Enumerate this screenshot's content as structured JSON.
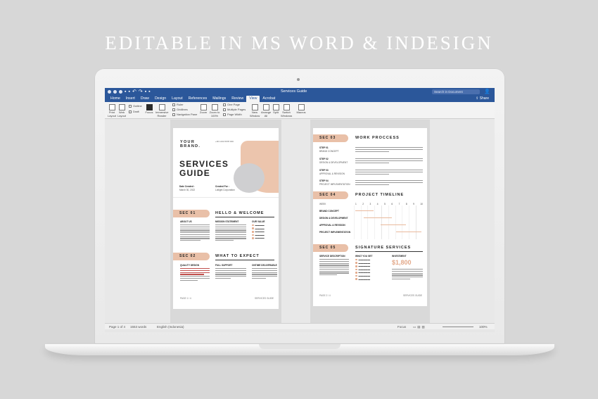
{
  "hero": {
    "title": "EDITABLE IN MS WORD & INDESIGN"
  },
  "app": {
    "doc_title": "Services Guide",
    "search_placeholder": "Search in Document",
    "share_label": "Share",
    "tabs": [
      "Home",
      "Insert",
      "Draw",
      "Design",
      "Layout",
      "References",
      "Mailings",
      "Review",
      "View",
      "Acrobat"
    ],
    "active_tab": "View",
    "ribbon": {
      "print_layout": "Print Layout",
      "web_layout": "Web Layout",
      "outline": "Outline",
      "draft": "Draft",
      "focus": "Focus",
      "immersive_reader": "Immersive Reader",
      "ruler": "Ruler",
      "gridlines": "Gridlines",
      "navigation_pane": "Navigation Pane",
      "zoom": "Zoom",
      "zoom_100": "Zoom to 100%",
      "one_page": "One Page",
      "multiple_pages": "Multiple Pages",
      "page_width": "Page Width",
      "new_window": "New Window",
      "arrange_all": "Arrange All",
      "split": "Split",
      "switch_windows": "Switch Windows",
      "macros": "Macros"
    },
    "status": {
      "page": "Page 1 of 4",
      "words": "1553 words",
      "language": "English (Indonesia)",
      "focus": "Focus",
      "zoom": "100%"
    }
  },
  "page_left": {
    "brand": "YOUR BRAND.",
    "header_meta": "+00 1234 5678 000",
    "title_line1": "SERVICES",
    "title_line2": "GUIDE",
    "date_created_label": "Date Created :",
    "date_created_value": "March 30, 2022",
    "created_for_label": "Created For :",
    "created_for_value": "Lotlight Corporation",
    "sec01": "SEC 01",
    "sec01_title": "HELLO & WELCOME",
    "about_us": "ABOUT US",
    "mission": "MISSION STATEMENT",
    "our_value": "OUR VALUE",
    "sec02": "SEC 02",
    "sec02_title": "WHAT TO EXPECT",
    "quality": "QUALITY DESIGN",
    "support": "FULL SUPPORT",
    "ontime": "ONTIME DELIVERABLE",
    "footer_left": "PAGE 1 / 4",
    "footer_right": "SERVICES GUIDE"
  },
  "page_right": {
    "sec03": "SEC 03",
    "sec03_title": "WORK PROCCESS",
    "steps": [
      {
        "num": "STEP 01",
        "name": "BRAND CONCEPT"
      },
      {
        "num": "STEP 02",
        "name": "DESIGN & DEVELOPMENT"
      },
      {
        "num": "STEP 03",
        "name": "APPROVAL & REVISION"
      },
      {
        "num": "STEP 04",
        "name": "PROJECT IMPLEMENTATION"
      }
    ],
    "sec04": "SEC 04",
    "sec04_title": "PROJECT TIMELINE",
    "timeline_week": "WEEK",
    "timeline_cols": [
      "1",
      "2",
      "3",
      "4",
      "5",
      "6",
      "7",
      "8",
      "9",
      "10"
    ],
    "timeline_rows": [
      "BRAND CONCEPT",
      "DESIGN & DEVELOPMENT",
      "APPROVAL & REVISION",
      "PROJECT IMPLEMENTATION"
    ],
    "sec05": "SEC 05",
    "sec05_title": "SIGNATURE SERVICES",
    "service_desc": "SERVICE DESCRIPTION",
    "what_you_get": "WHAT YOU GET",
    "investment": "INVESTMENT",
    "price": "$1,800",
    "footer_left": "PAGE 2 / 4",
    "footer_right": "SERVICES GUIDE"
  },
  "colors": {
    "accent": "#e9c0a8",
    "word_blue": "#2b579a",
    "hero_text": "#ffffff"
  }
}
